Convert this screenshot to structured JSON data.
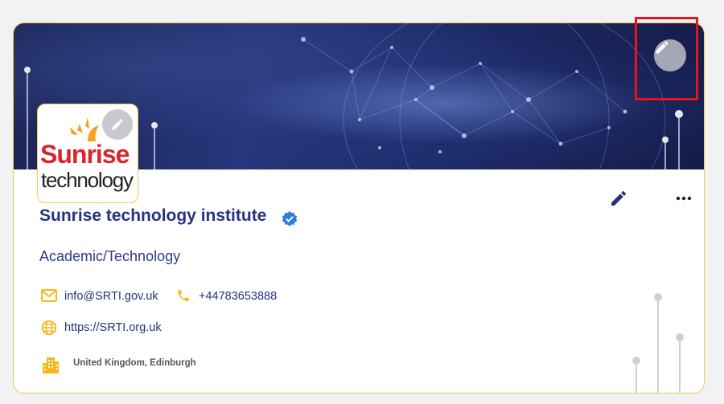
{
  "profile": {
    "name": "Sunrise technology institute",
    "category": "Academic/Technology",
    "email": "info@SRTI.gov.uk",
    "phone": "+44783653888",
    "website": "https://SRTI.org.uk",
    "location": "United Kingdom, Edinburgh",
    "verified": true
  },
  "logo": {
    "line1": "Sunrise",
    "line2": "technology"
  },
  "icons": {
    "banner_edit": "pencil-icon",
    "logo_edit": "pencil-icon",
    "profile_edit": "pencil-icon",
    "more": "more-horizontal-icon",
    "verified": "verified-badge-icon",
    "email": "mail-icon",
    "phone": "phone-icon",
    "website": "globe-icon",
    "location": "building-icon"
  },
  "colors": {
    "accent": "#273280",
    "border": "#f1c84b",
    "icon_yellow": "#f2b81c",
    "verified_blue": "#2f7de1",
    "highlight_red": "#e8141c"
  }
}
